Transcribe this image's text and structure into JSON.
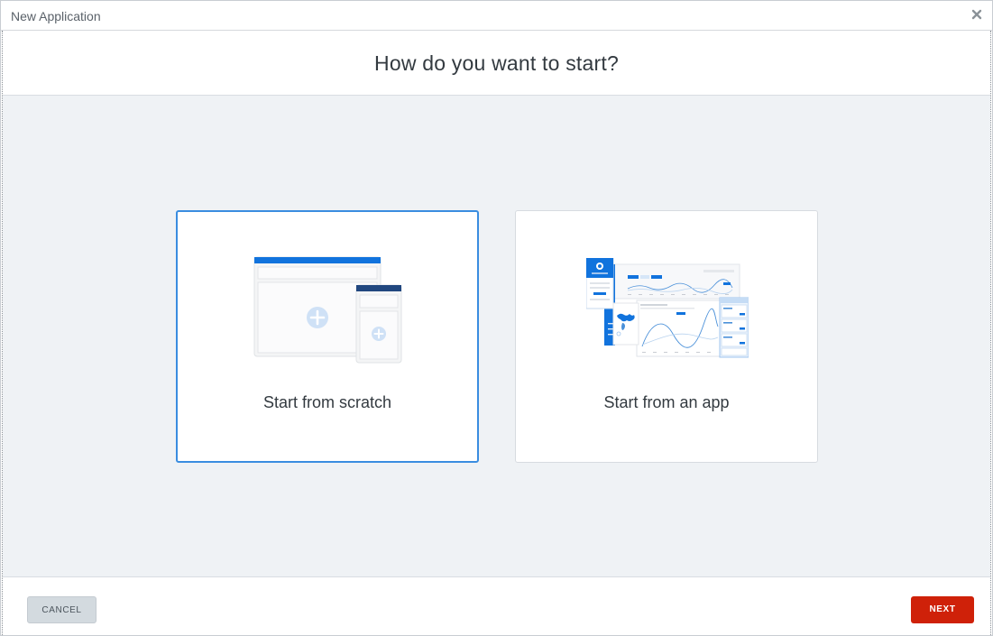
{
  "window": {
    "title": "New Application",
    "close_icon": "close-icon"
  },
  "header": {
    "heading": "How do you want to start?"
  },
  "options": [
    {
      "id": "scratch",
      "label": "Start from scratch",
      "selected": true,
      "illustration": "blank-layout-illustration"
    },
    {
      "id": "app",
      "label": "Start from an app",
      "selected": false,
      "illustration": "app-screens-illustration"
    }
  ],
  "footer": {
    "cancel_label": "CANCEL",
    "next_label": "NEXT"
  },
  "colors": {
    "accent_blue": "#3a8de0",
    "next_red": "#cf2109",
    "panel_bg": "#eff2f5"
  }
}
